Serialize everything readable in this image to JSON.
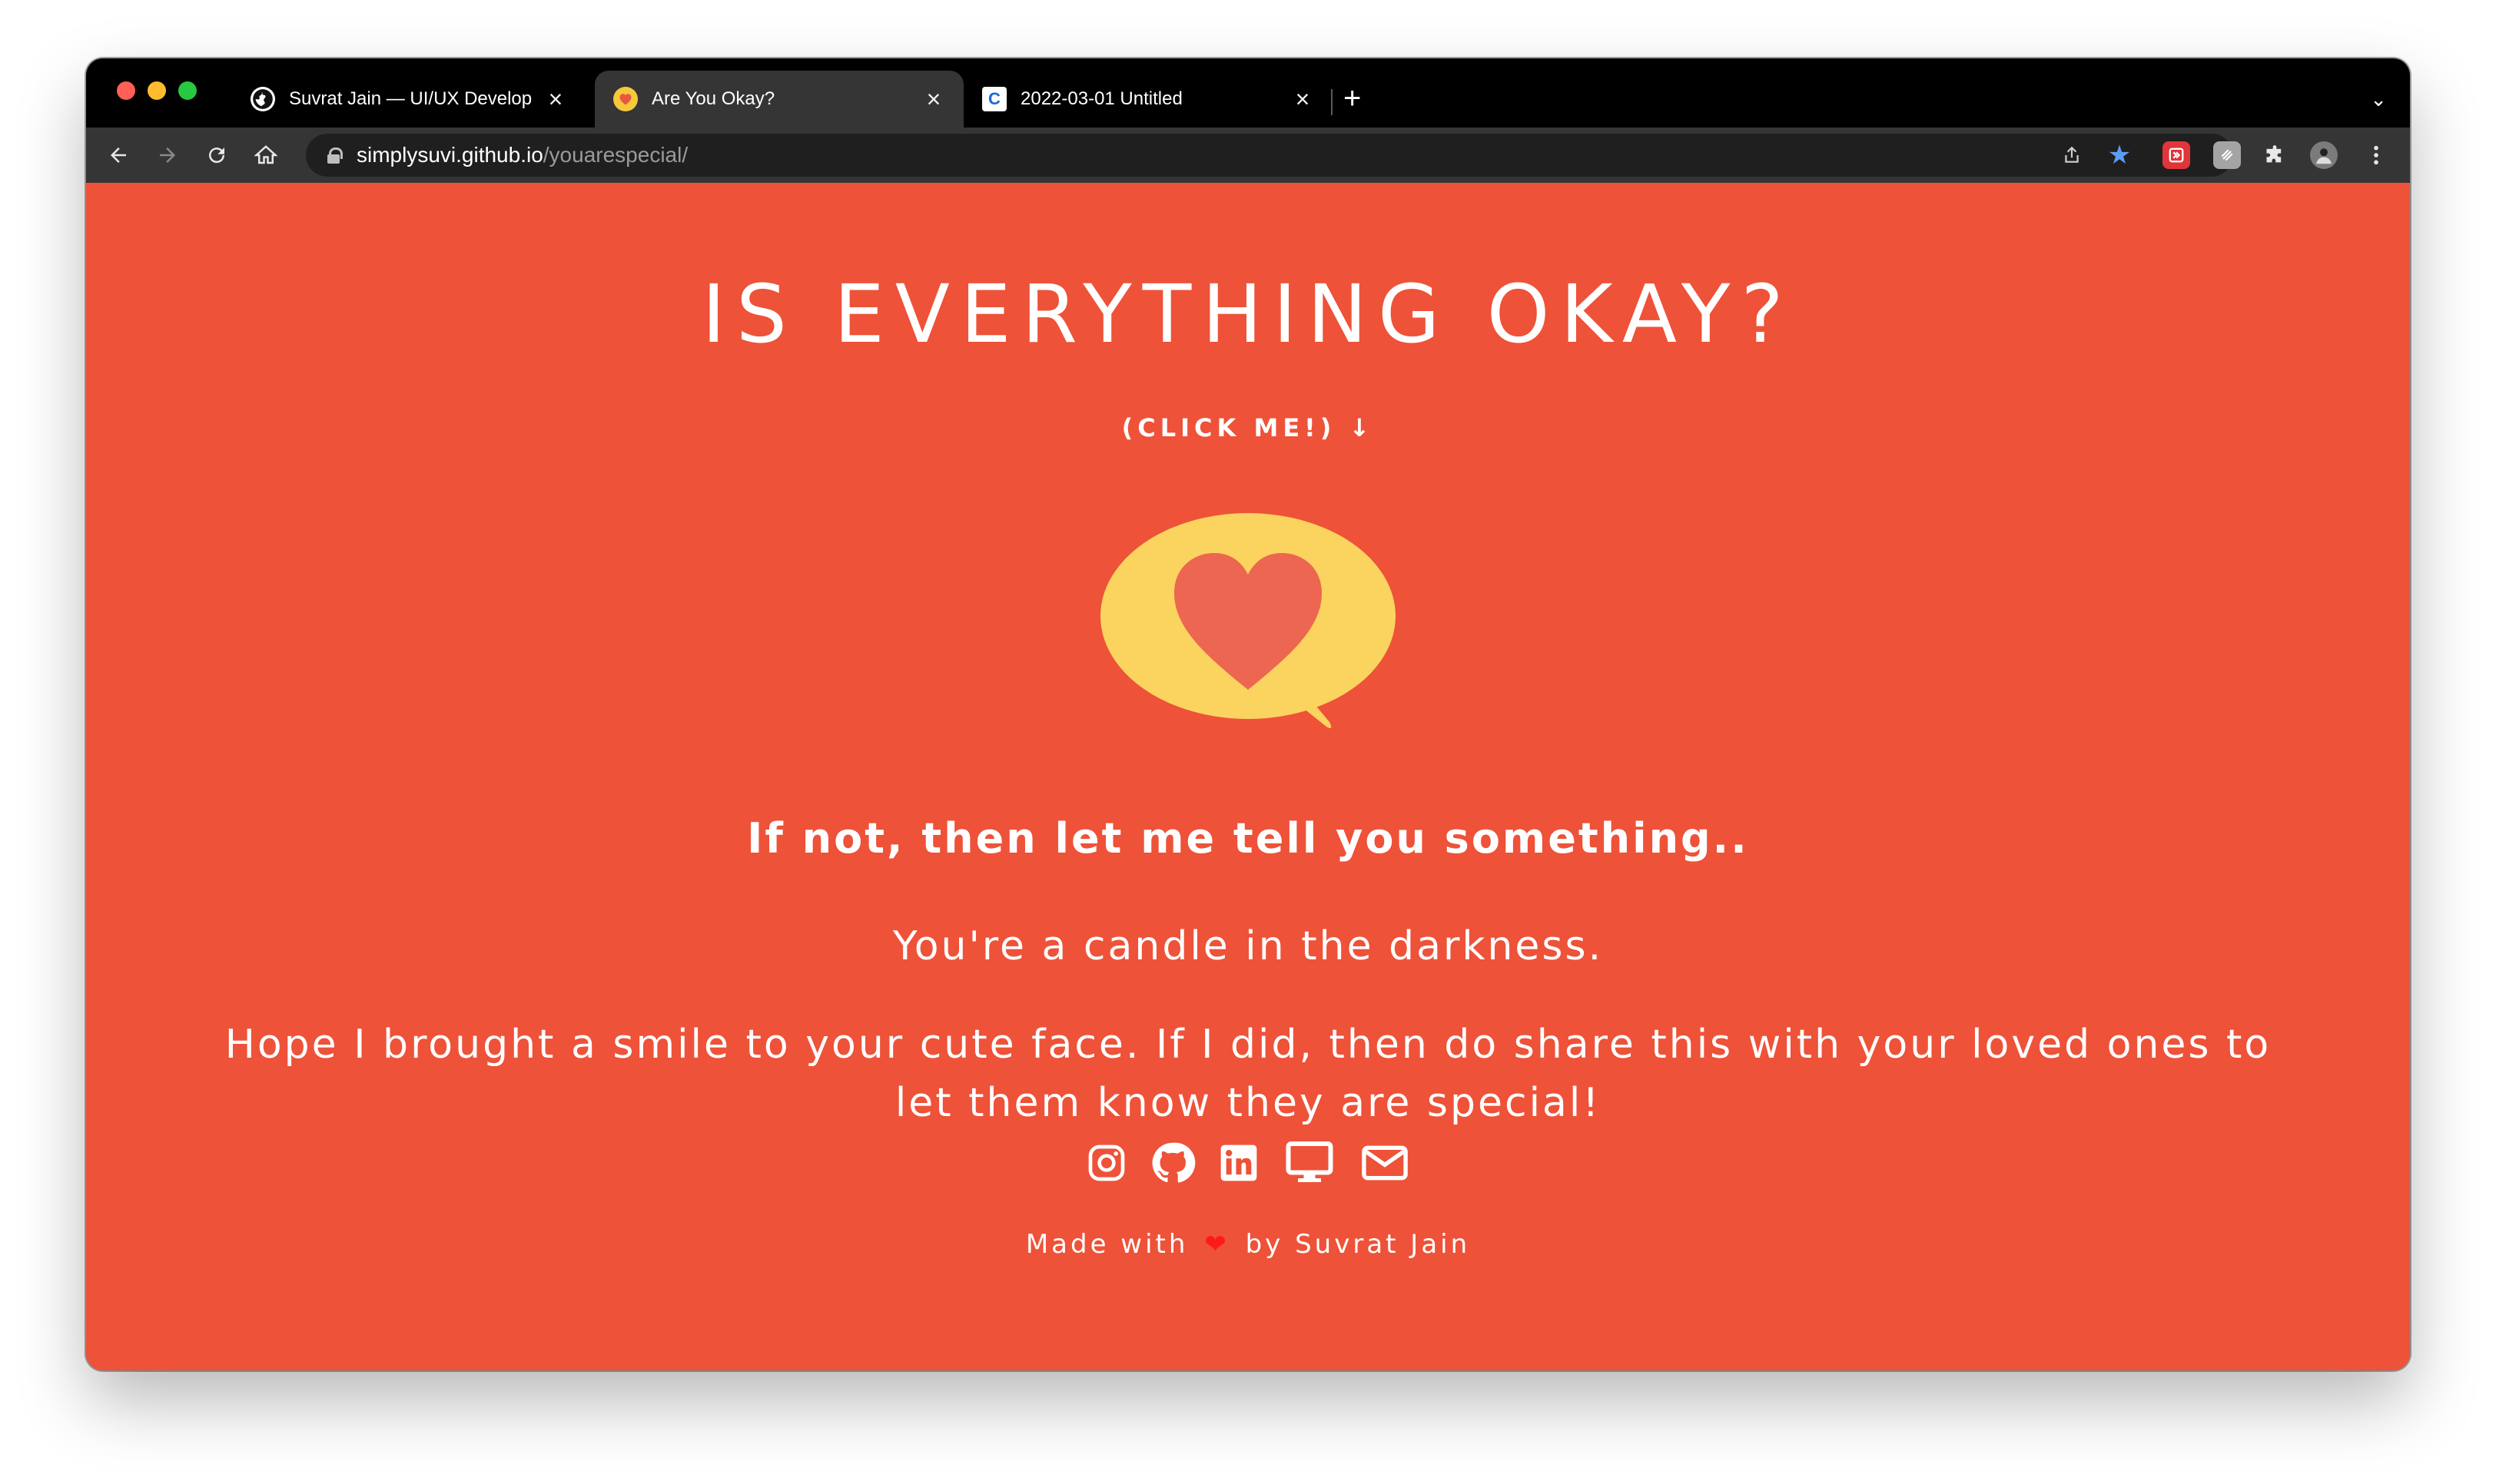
{
  "browser": {
    "tabs": [
      {
        "title": "Suvrat Jain — UI/UX Developer",
        "favicon": "globe-icon",
        "active": false
      },
      {
        "title": "Are You Okay?",
        "favicon": "heart-icon",
        "active": true
      },
      {
        "title": "2022-03-01 Untitled",
        "favicon": "c-icon",
        "active": false
      }
    ],
    "close_glyph": "×",
    "new_tab_glyph": "+",
    "tab_menu_glyph": "⌄",
    "url_host": "simplysuvi.github.io",
    "url_path": "/youarespecial/"
  },
  "page": {
    "headline": "IS EVERYTHING OKAY?",
    "click_me": "(CLICK ME!) ↓",
    "lead": "If not, then let me tell you something..",
    "message": "You're a candle in the darkness.",
    "hope": "Hope I brought a smile to your cute face. If I did, then do share this with your loved ones to let them know they are special!",
    "socials": [
      "instagram-icon",
      "github-icon",
      "linkedin-icon",
      "desktop-icon",
      "mail-icon"
    ],
    "footer_prefix": "Made with",
    "footer_heart": "❤",
    "footer_suffix": "by Suvrat Jain"
  },
  "colors": {
    "background": "#ee5238",
    "bubble": "#fbd35f",
    "heart": "#ec6651",
    "footer_heart": "#ff1a1a"
  }
}
